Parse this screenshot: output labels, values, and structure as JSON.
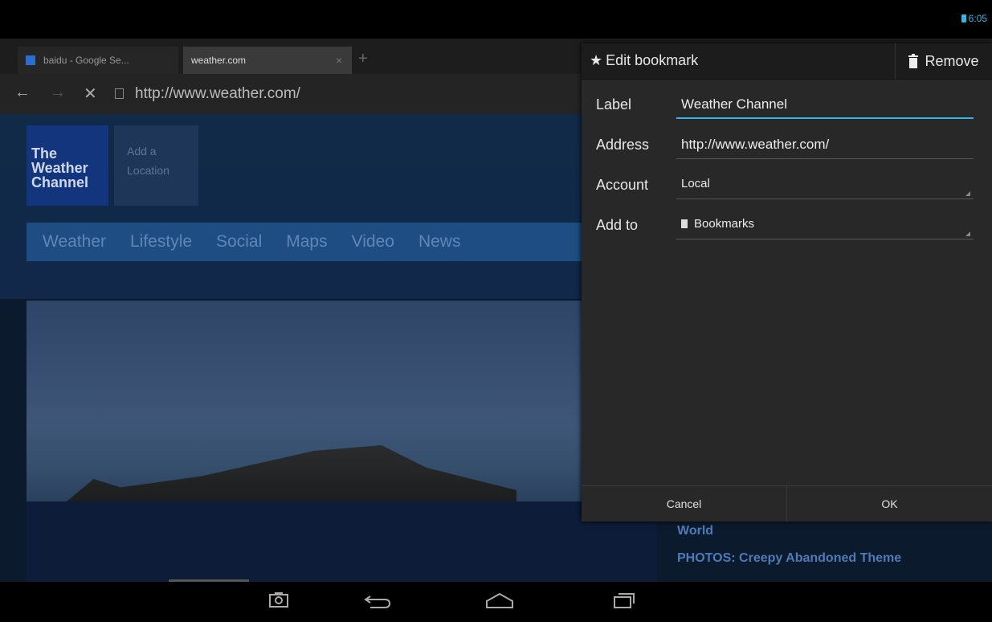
{
  "status": {
    "time": "6:05"
  },
  "tabs": [
    {
      "label": "baidu - Google Se..."
    },
    {
      "label": "weather.com",
      "close": "×"
    }
  ],
  "newtab": "+",
  "url": {
    "text": "http://www.weather.com/"
  },
  "page": {
    "logo": [
      "The",
      "Weather",
      "Channel"
    ],
    "add_location": [
      "Add a",
      "Location"
    ],
    "nav": [
      "Weather",
      "Lifestyle",
      "Social",
      "Maps",
      "Video",
      "News"
    ],
    "side_links": [
      "World",
      "PHOTOS: Creepy Abandoned Theme"
    ]
  },
  "dialog": {
    "title": "Edit bookmark",
    "remove": "Remove",
    "fields": {
      "label": {
        "label": "Label",
        "value": "Weather Channel"
      },
      "address": {
        "label": "Address",
        "value": "http://www.weather.com/"
      },
      "account": {
        "label": "Account",
        "value": "Local"
      },
      "add_to": {
        "label": "Add to",
        "value": "Bookmarks"
      }
    },
    "cancel": "Cancel",
    "ok": "OK"
  },
  "colors": {
    "accent": "#33b5e5",
    "dialog_bg": "#282828"
  }
}
